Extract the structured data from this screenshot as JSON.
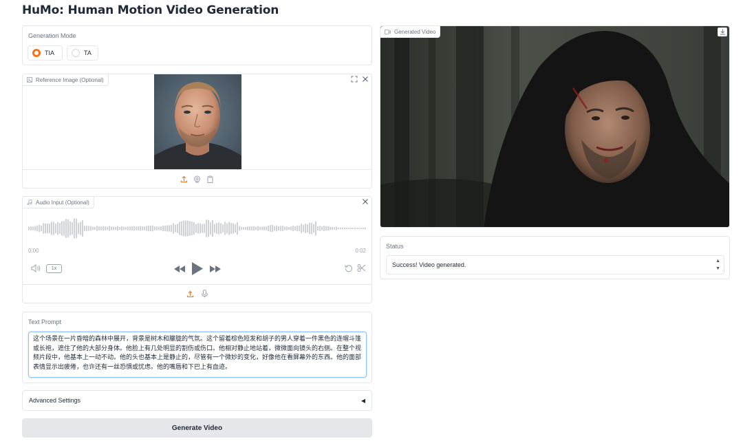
{
  "app": {
    "title": "HuMo: Human Motion Video Generation"
  },
  "generation_mode": {
    "label": "Generation Mode",
    "options": [
      "TIA",
      "TA"
    ],
    "selected": "TIA"
  },
  "reference_image": {
    "label": "Reference Image (Optional)",
    "icons": [
      "image-icon",
      "fullscreen-icon",
      "close-icon",
      "upload-icon",
      "webcam-icon",
      "clipboard-icon"
    ]
  },
  "audio_input": {
    "label": "Audio Input (Optional)",
    "time_start": "0:00",
    "time_end": "0:02",
    "speed": "1x"
  },
  "text_prompt": {
    "label": "Text Prompt",
    "value": "这个场景在一片昏暗的森林中展开，背景是树木和朦胧的气氛。这个留着棕色短发和胡子的男人穿着一件黑色的连帽斗篷或长袍，遮住了他的大部分身体。他脸上有几处明显的割伤或伤口。他相对静止地站着，微微面向镜头的右侧。在整个视频片段中，他基本上一动不动。他的头也基本上是静止的，尽管有一个微妙的变化，好像他在看屏幕外的东西。他的面部表情显示出疲倦，也许还有一丝恐惧或忧虑。他的嘴唇和下巴上有血迹。"
  },
  "advanced_settings": {
    "label": "Advanced Settings",
    "arrow": "◀"
  },
  "generate_button": {
    "label": "Generate Video"
  },
  "generated_video": {
    "label": "Generated Video"
  },
  "status": {
    "label": "Status",
    "value": "Success! Video generated."
  },
  "colors": {
    "accent": "#f97316",
    "focus": "#93c5fd",
    "border": "#e5e7eb"
  }
}
